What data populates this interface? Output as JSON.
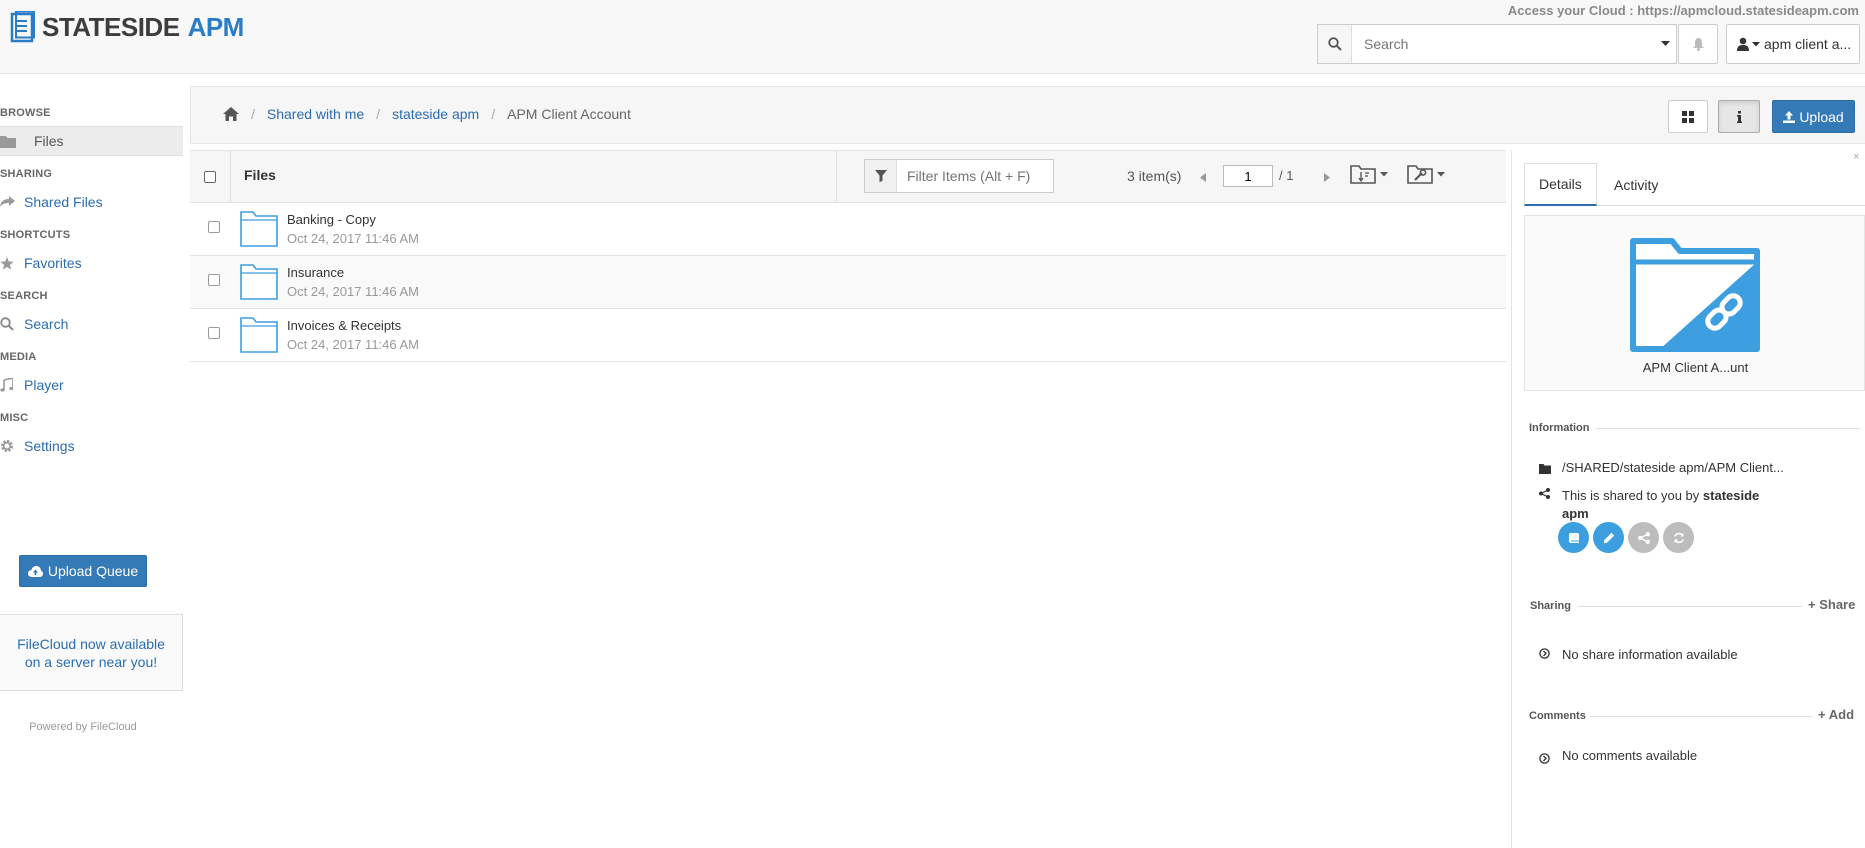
{
  "header": {
    "logo_part1": "STATESIDE",
    "logo_part2": "APM",
    "access_text": "Access your Cloud : https://apmcloud.statesideapm.com",
    "search_placeholder": "Search",
    "user_label": "apm client a..."
  },
  "sidebar": {
    "browse_head": "BROWSE",
    "files": "Files",
    "sharing_head": "SHARING",
    "shared_files": "Shared Files",
    "shortcuts_head": "SHORTCUTS",
    "favorites": "Favorites",
    "search_head": "SEARCH",
    "search": "Search",
    "media_head": "MEDIA",
    "player": "Player",
    "misc_head": "MISC",
    "settings": "Settings",
    "upload_queue": "Upload Queue",
    "promo": "FileCloud now available on a server near you!",
    "powered": "Powered by FileCloud"
  },
  "breadcrumb": {
    "item1": "Shared with me",
    "item2": "stateside apm",
    "current": "APM Client Account"
  },
  "toolbar": {
    "upload_label": "Upload"
  },
  "list": {
    "header_title": "Files",
    "filter_placeholder": "Filter Items (Alt + F)",
    "item_count": "3 item(s)",
    "page_current": "1",
    "page_total": "/ 1",
    "rows": [
      {
        "name": "Banking - Copy",
        "date": "Oct 24, 2017 11:46 AM"
      },
      {
        "name": "Insurance",
        "date": "Oct 24, 2017 11:46 AM"
      },
      {
        "name": "Invoices & Receipts",
        "date": "Oct 24, 2017 11:46 AM"
      }
    ]
  },
  "panel": {
    "close": "×",
    "tab_details": "Details",
    "tab_activity": "Activity",
    "preview_name": "APM Client A...unt",
    "information_head": "Information",
    "path": "/SHARED/stateside apm/APM Client...",
    "shared_text": "This is shared to you by ",
    "shared_by_line1": "stateside",
    "shared_by_line2": "apm",
    "sharing_head": "Sharing",
    "share_action": "Share",
    "no_share": "No share information available",
    "comments_head": "Comments",
    "add_action": "Add",
    "no_comments": "No comments available"
  },
  "colors": {
    "brand_blue": "#337ab7",
    "link_blue": "#2a6db0",
    "folder_blue": "#3d9ee0"
  }
}
